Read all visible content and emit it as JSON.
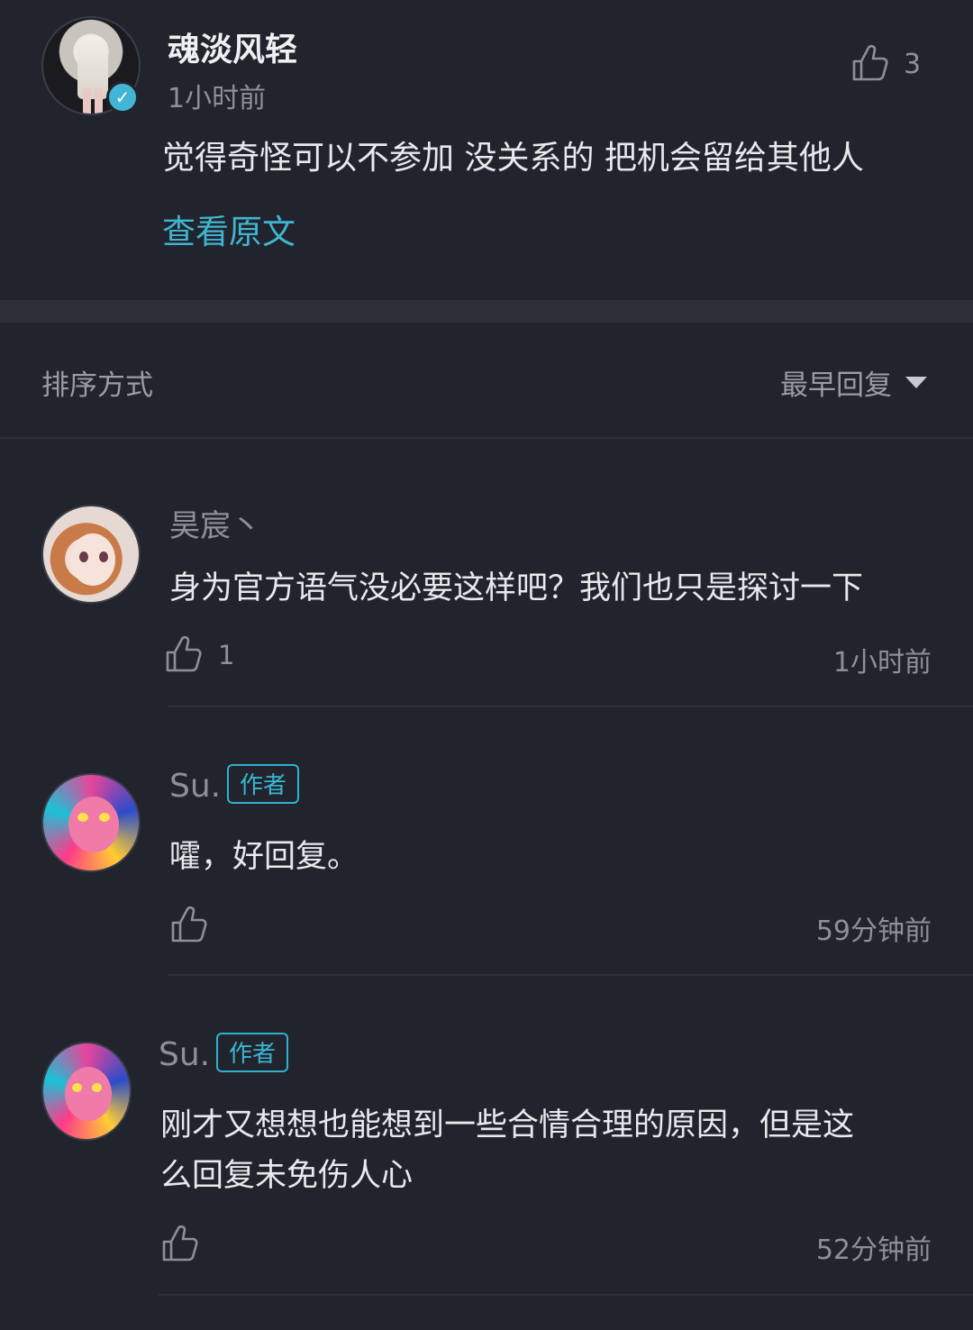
{
  "comment": {
    "username": "魂淡风轻",
    "time": "1小时前",
    "like_count": "3",
    "text": "觉得奇怪可以不参加 没关系的 把机会留给其他人",
    "view_original": "查看原文",
    "avatar_icon": "user-avatar",
    "verified_icon": "verified-check-icon"
  },
  "sort": {
    "label": "排序方式",
    "selected": "最早回复"
  },
  "replies": [
    {
      "username": "昊宸丶",
      "badge": "",
      "text": "身为官方语气没必要这样吧？我们也只是探讨一下",
      "like_count": "1",
      "time": "1小时前"
    },
    {
      "username": "Su.",
      "badge": "作者",
      "text": "嚯，好回复。",
      "like_count": "",
      "time": "59分钟前"
    },
    {
      "username": "Su.",
      "badge": "作者",
      "text_line1": "刚才又想想也能想到一些合情合理的原因，但是这",
      "text_line2": "么回复未免伤人心",
      "like_count": "",
      "time": "52分钟前"
    }
  ],
  "colors": {
    "background": "#22242d",
    "accent": "#3fb6d0"
  }
}
